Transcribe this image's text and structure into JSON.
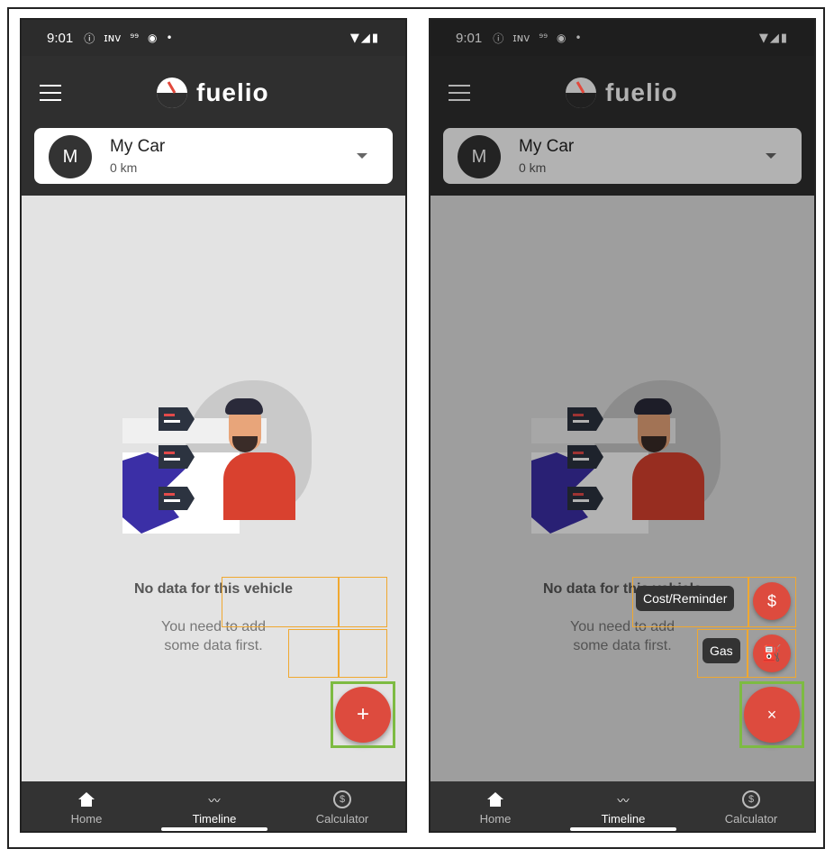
{
  "status": {
    "time": "9:01",
    "icons": [
      "info-icon",
      "inv-icon",
      "quote-icon",
      "circle-icon",
      "dot-icon"
    ],
    "right_icons": [
      "wifi-icon",
      "signal-icon",
      "battery-icon"
    ]
  },
  "app": {
    "name": "fuelio"
  },
  "vehicle": {
    "avatar_letter": "M",
    "name": "My Car",
    "odometer": "0 km"
  },
  "empty_state": {
    "title": "No data for this vehicle",
    "line1": "You need to add",
    "line2": "some data first."
  },
  "fab": {
    "add_symbol": "+",
    "close_symbol": "×"
  },
  "speed_dial": {
    "cost": {
      "label": "Cost/Reminder",
      "icon_symbol": "$"
    },
    "gas": {
      "label": "Gas",
      "icon_symbol": "⛽"
    }
  },
  "nav": {
    "home": "Home",
    "timeline": "Timeline",
    "calculator": "Calculator",
    "timeline_symbol": "〰",
    "calc_symbol": "$"
  },
  "colors": {
    "accent": "#dd4b3e",
    "appbar": "#2f2f2f",
    "navbar": "#333333",
    "selection_green": "#7dbb42",
    "selection_orange": "#f0a830"
  }
}
